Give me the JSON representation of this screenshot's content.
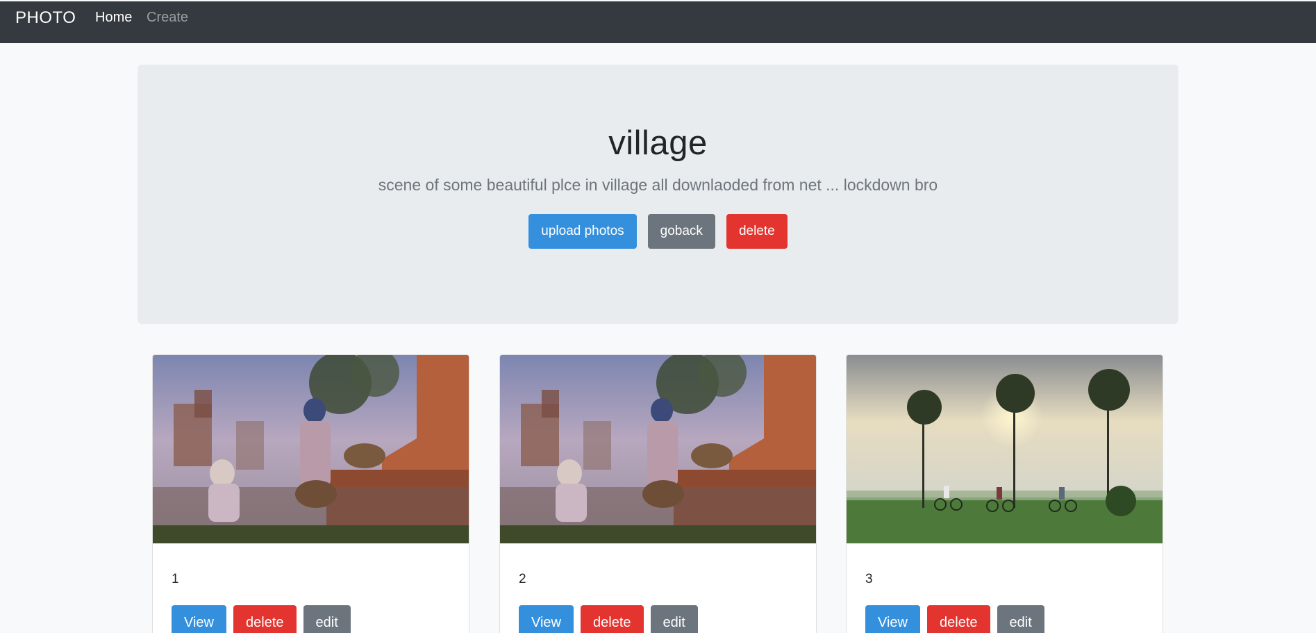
{
  "navbar": {
    "brand": "PHOTO",
    "links": [
      {
        "label": "Home",
        "active": true
      },
      {
        "label": "Create",
        "active": false
      }
    ]
  },
  "album": {
    "title": "village",
    "description": "scene of some beautiful plce in village all downlaoded from net ... lockdown bro",
    "actions": {
      "upload_label": "upload photos",
      "goback_label": "goback",
      "delete_label": "delete"
    }
  },
  "photos": [
    {
      "title": "1",
      "image": "village-women-ruins-photo",
      "view_label": "View",
      "delete_label": "delete",
      "edit_label": "edit"
    },
    {
      "title": "2",
      "image": "village-women-ruins-photo",
      "view_label": "View",
      "delete_label": "delete",
      "edit_label": "edit"
    },
    {
      "title": "3",
      "image": "cyclists-rice-field-sunrise-photo",
      "view_label": "View",
      "delete_label": "delete",
      "edit_label": "edit"
    }
  ],
  "colors": {
    "navbar_bg": "#343a40",
    "primary": "#3490dc",
    "secondary": "#6c757d",
    "danger": "#e3342f",
    "jumbotron_bg": "#e9ecef",
    "page_bg": "#f8f9fa"
  }
}
